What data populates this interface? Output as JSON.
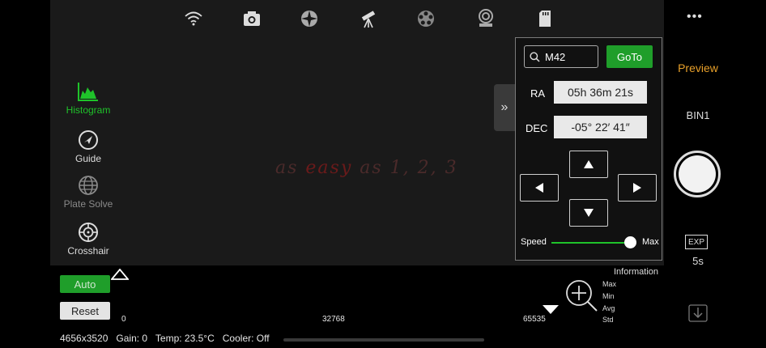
{
  "top_toolbar": {
    "icons": [
      "wifi-icon",
      "camera-icon",
      "focus-icon",
      "telescope-icon",
      "filter-wheel-icon",
      "mount-icon",
      "sd-card-icon"
    ]
  },
  "more_menu": "•••",
  "left_tools": [
    {
      "label": "Histogram",
      "active": true,
      "icon": "histogram-icon"
    },
    {
      "label": "Guide",
      "active": false,
      "icon": "guide-icon"
    },
    {
      "label": "Plate Solve",
      "active": false,
      "icon": "plate-solve-icon"
    },
    {
      "label": "Crosshair",
      "active": false,
      "icon": "crosshair-icon"
    }
  ],
  "watermark": {
    "pre": "as ",
    "easy": "easy",
    "post": " as 1, 2, 3"
  },
  "goto_panel": {
    "search_value": "M42",
    "goto_label": "GoTo",
    "ra_label": "RA",
    "ra_value": "05h 36m 21s",
    "dec_label": "DEC",
    "dec_value": "-05° 22′ 41″",
    "speed_label": "Speed",
    "speed_max_label": "Max",
    "speed_level": 1.0
  },
  "right_panel": {
    "preview_label": "Preview",
    "bin_label": "BIN1",
    "exp_label": "EXP",
    "exp_value": "5s"
  },
  "histogram": {
    "auto_label": "Auto",
    "reset_label": "Reset",
    "axis_min": "0",
    "axis_mid": "32768",
    "axis_max": "65535",
    "info_title": "Information",
    "stats": [
      "Max",
      "Min",
      "Avg",
      "Std"
    ]
  },
  "status": {
    "resolution": "4656x3520",
    "gain": "Gain: 0",
    "temp": "Temp: 23.5°C",
    "cooler": "Cooler: Off"
  },
  "colors": {
    "accent_green": "#1f9e2a",
    "preview_orange": "#e8a02a"
  }
}
